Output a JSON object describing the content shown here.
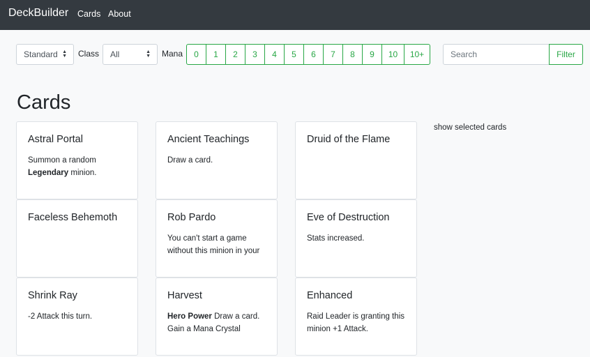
{
  "navbar": {
    "brand": "DeckBuilder",
    "links": [
      "Cards",
      "About"
    ]
  },
  "filters": {
    "format": "Standard",
    "class_label": "Class",
    "class_value": "All",
    "mana_label": "Mana",
    "mana_buttons": [
      "0",
      "1",
      "2",
      "3",
      "4",
      "5",
      "6",
      "7",
      "8",
      "9",
      "10",
      "10+"
    ],
    "search_placeholder": "Search",
    "filter_label": "Filter"
  },
  "page_title": "Cards",
  "show_selected": "show selected cards",
  "cards": [
    {
      "title": "Astral Portal",
      "text": [
        {
          "t": "Summon a random ",
          "b": false
        },
        {
          "t": "Legendary",
          "b": true
        },
        {
          "t": " minion.",
          "b": false
        }
      ]
    },
    {
      "title": "Ancient Teachings",
      "text": [
        {
          "t": "Draw a card.",
          "b": false
        }
      ]
    },
    {
      "title": "Druid of the Flame",
      "text": []
    },
    {
      "title": "Faceless Behemoth",
      "text": []
    },
    {
      "title": "Rob Pardo",
      "text": [
        {
          "t": "You can't start a game without this minion in your",
          "b": false
        }
      ]
    },
    {
      "title": "Eve of Destruction",
      "text": [
        {
          "t": "Stats increased.",
          "b": false
        }
      ]
    },
    {
      "title": "Shrink Ray",
      "text": [
        {
          "t": "-2 Attack this turn.",
          "b": false
        }
      ]
    },
    {
      "title": "Harvest",
      "text": [
        {
          "t": "Hero Power",
          "b": true
        },
        {
          "t": " Draw a card. Gain a Mana Crystal",
          "b": false
        }
      ]
    },
    {
      "title": "Enhanced",
      "text": [
        {
          "t": "Raid Leader is granting this minion +1 Attack.",
          "b": false
        }
      ]
    }
  ],
  "colors": {
    "navbar_bg": "#343a40",
    "accent_green": "#28a745",
    "page_bg": "#f8f9fa"
  }
}
